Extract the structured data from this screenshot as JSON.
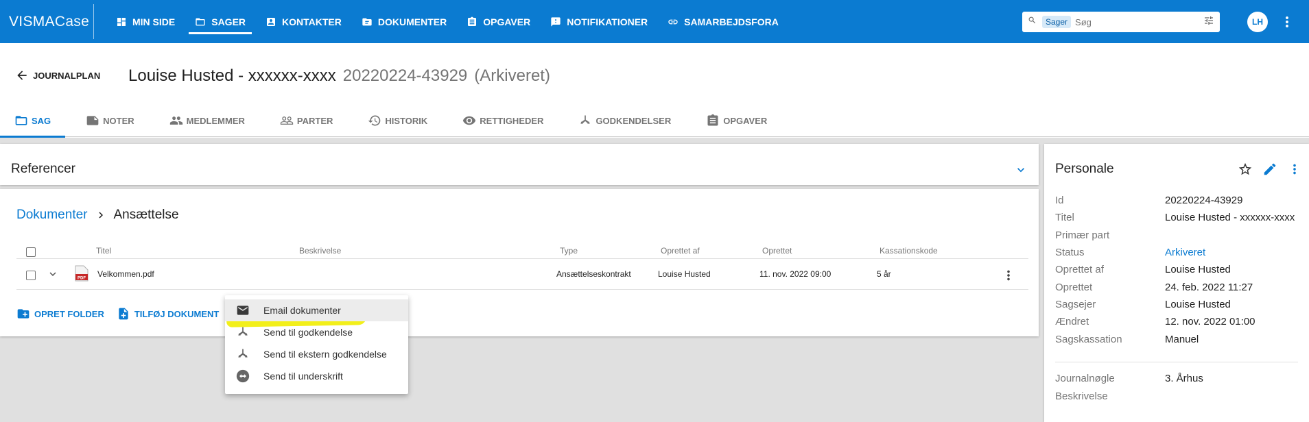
{
  "brand": {
    "part1": "VISMA",
    "part2": "Case"
  },
  "nav": [
    {
      "label": "MIN SIDE",
      "icon": "dashboard-icon"
    },
    {
      "label": "SAGER",
      "icon": "folder-icon",
      "active": true
    },
    {
      "label": "KONTAKTER",
      "icon": "contact-icon"
    },
    {
      "label": "DOKUMENTER",
      "icon": "document-folder-icon"
    },
    {
      "label": "OPGAVER",
      "icon": "clipboard-icon"
    },
    {
      "label": "NOTIFIKATIONER",
      "icon": "notification-icon"
    },
    {
      "label": "SAMARBEJDSFORA",
      "icon": "link-icon"
    }
  ],
  "search": {
    "chip": "Sager",
    "placeholder": "Søg"
  },
  "user": {
    "initials": "LH"
  },
  "header": {
    "back_label": "JOURNALPLAN",
    "title": "Louise Husted - xxxxxx-xxxx",
    "case_number": "20220224-43929",
    "state": "(Arkiveret)"
  },
  "tabs": [
    {
      "label": "SAG",
      "active": true
    },
    {
      "label": "NOTER"
    },
    {
      "label": "MEDLEMMER"
    },
    {
      "label": "PARTER"
    },
    {
      "label": "HISTORIK"
    },
    {
      "label": "RETTIGHEDER"
    },
    {
      "label": "GODKENDELSER"
    },
    {
      "label": "OPGAVER"
    }
  ],
  "references": {
    "title": "Referencer"
  },
  "documents": {
    "breadcrumb_root": "Dokumenter",
    "breadcrumb_current": "Ansættelse",
    "columns": {
      "title": "Titel",
      "description": "Beskrivelse",
      "type": "Type",
      "created_by": "Oprettet af",
      "created": "Oprettet",
      "retention": "Kassationskode"
    },
    "rows": [
      {
        "title": "Velkommen.pdf",
        "description": "",
        "type": "Ansættelseskontrakt",
        "created_by": "Louise Husted",
        "created": "11. nov. 2022 09:00",
        "retention": "5 år"
      }
    ],
    "actions": {
      "create_folder": "OPRET FOLDER",
      "add_document": "TILFØJ DOKUMENT"
    }
  },
  "context_menu": [
    {
      "label": "Email dokumenter",
      "icon": "email-icon",
      "highlighted": true
    },
    {
      "label": "Send til godkendelse",
      "icon": "approval-icon"
    },
    {
      "label": "Send til ekstern godkendelse",
      "icon": "approval-icon"
    },
    {
      "label": "Send til underskrift",
      "icon": "signature-icon"
    }
  ],
  "details": {
    "title": "Personale",
    "fields": [
      {
        "key": "Id",
        "value": "20220224-43929"
      },
      {
        "key": "Titel",
        "value": "Louise Husted - xxxxxx-xxxx"
      },
      {
        "key": "Primær part",
        "value": ""
      },
      {
        "key": "Status",
        "value": "Arkiveret"
      },
      {
        "key": "Oprettet af",
        "value": "Louise Husted"
      },
      {
        "key": "Oprettet",
        "value": "24. feb. 2022 11:27"
      },
      {
        "key": "Sagsejer",
        "value": "Louise Husted"
      },
      {
        "key": "Ændret",
        "value": "12. nov. 2022 01:00"
      },
      {
        "key": "Sagskassation",
        "value": "Manuel"
      }
    ],
    "extra_fields": [
      {
        "key": "Journalnøgle",
        "value": "3. Århus"
      },
      {
        "key": "Beskrivelse",
        "value": ""
      }
    ]
  }
}
